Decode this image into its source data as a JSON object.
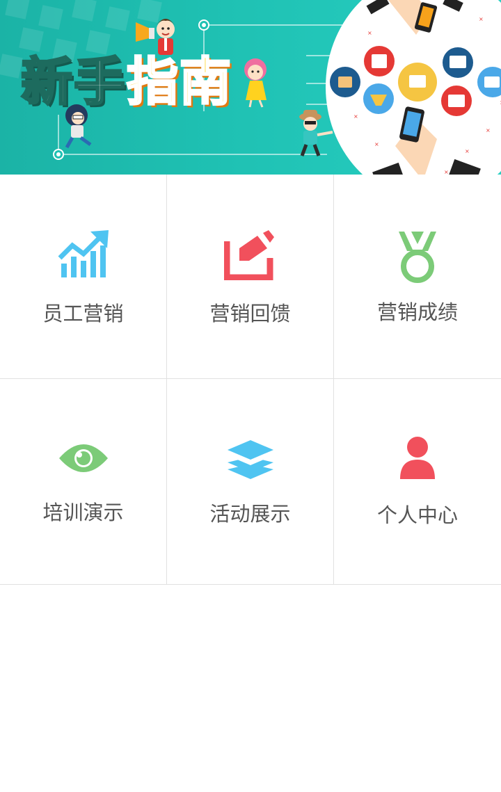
{
  "banner": {
    "title_part1": "新手",
    "title_part2": "指南"
  },
  "menu": {
    "items": [
      {
        "label": "员工营销",
        "icon": "chart-growth-icon",
        "color": "#4fc4f1"
      },
      {
        "label": "营销回馈",
        "icon": "edit-box-icon",
        "color": "#f1505c"
      },
      {
        "label": "营销成绩",
        "icon": "medal-icon",
        "color": "#7ccb78"
      },
      {
        "label": "培训演示",
        "icon": "eye-icon",
        "color": "#7ccb78"
      },
      {
        "label": "活动展示",
        "icon": "layers-icon",
        "color": "#4fc4f1"
      },
      {
        "label": "个人中心",
        "icon": "user-icon",
        "color": "#f1505c"
      }
    ]
  }
}
